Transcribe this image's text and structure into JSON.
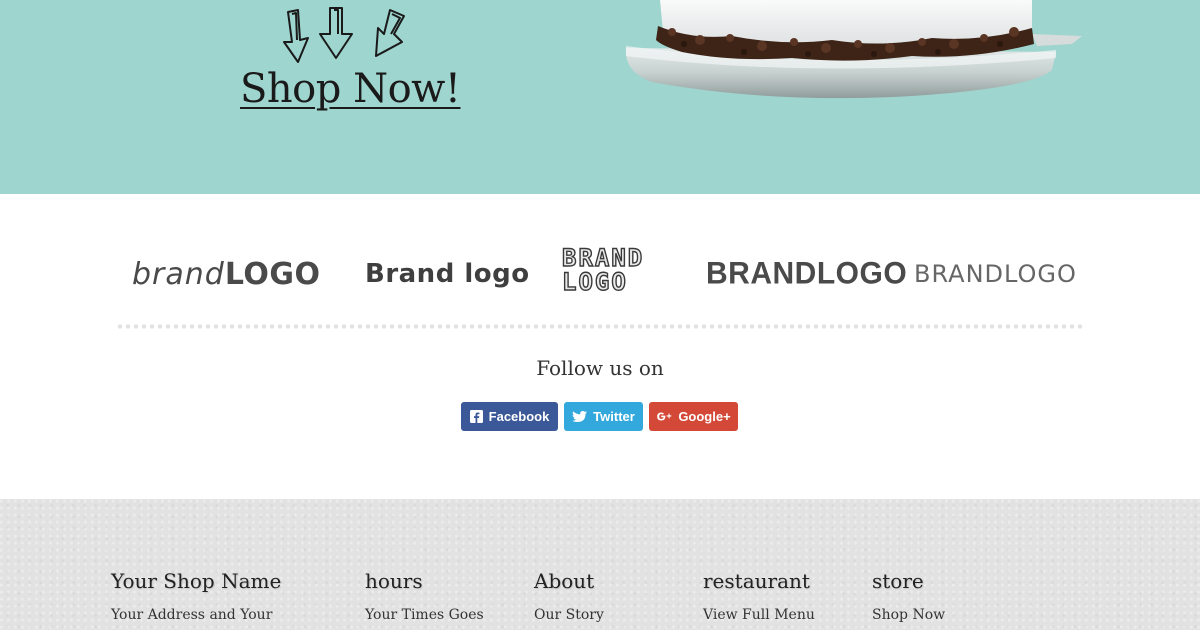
{
  "hero": {
    "cta_label": "Shop Now!",
    "background_color": "#9fd5cf"
  },
  "brand_logos": [
    "brandLOGO",
    "Brand logo",
    "BRAND LOGO",
    "BRANDLOGO",
    "BRANDLOGO"
  ],
  "brand_logo_parts": {
    "logo1_left": "brand",
    "logo1_right": "LOGO",
    "logo3_line1": "BRAND",
    "logo3_line2": "LOGO"
  },
  "social": {
    "heading": "Follow us on",
    "buttons": [
      {
        "label": "Facebook",
        "icon": "facebook-icon",
        "color": "#3b5998"
      },
      {
        "label": "Twitter",
        "icon": "twitter-icon",
        "color": "#33a8dc"
      },
      {
        "label": "Google+",
        "icon": "google-plus-icon",
        "color": "#d34836"
      }
    ]
  },
  "footer": {
    "columns": [
      {
        "heading": "Your Shop Name",
        "item": "Your Address and Your"
      },
      {
        "heading": "hours",
        "item": "Your Times Goes"
      },
      {
        "heading": "About",
        "item": "Our Story"
      },
      {
        "heading": "restaurant",
        "item": "View Full Menu"
      },
      {
        "heading": "store",
        "item": "Shop Now"
      }
    ]
  }
}
